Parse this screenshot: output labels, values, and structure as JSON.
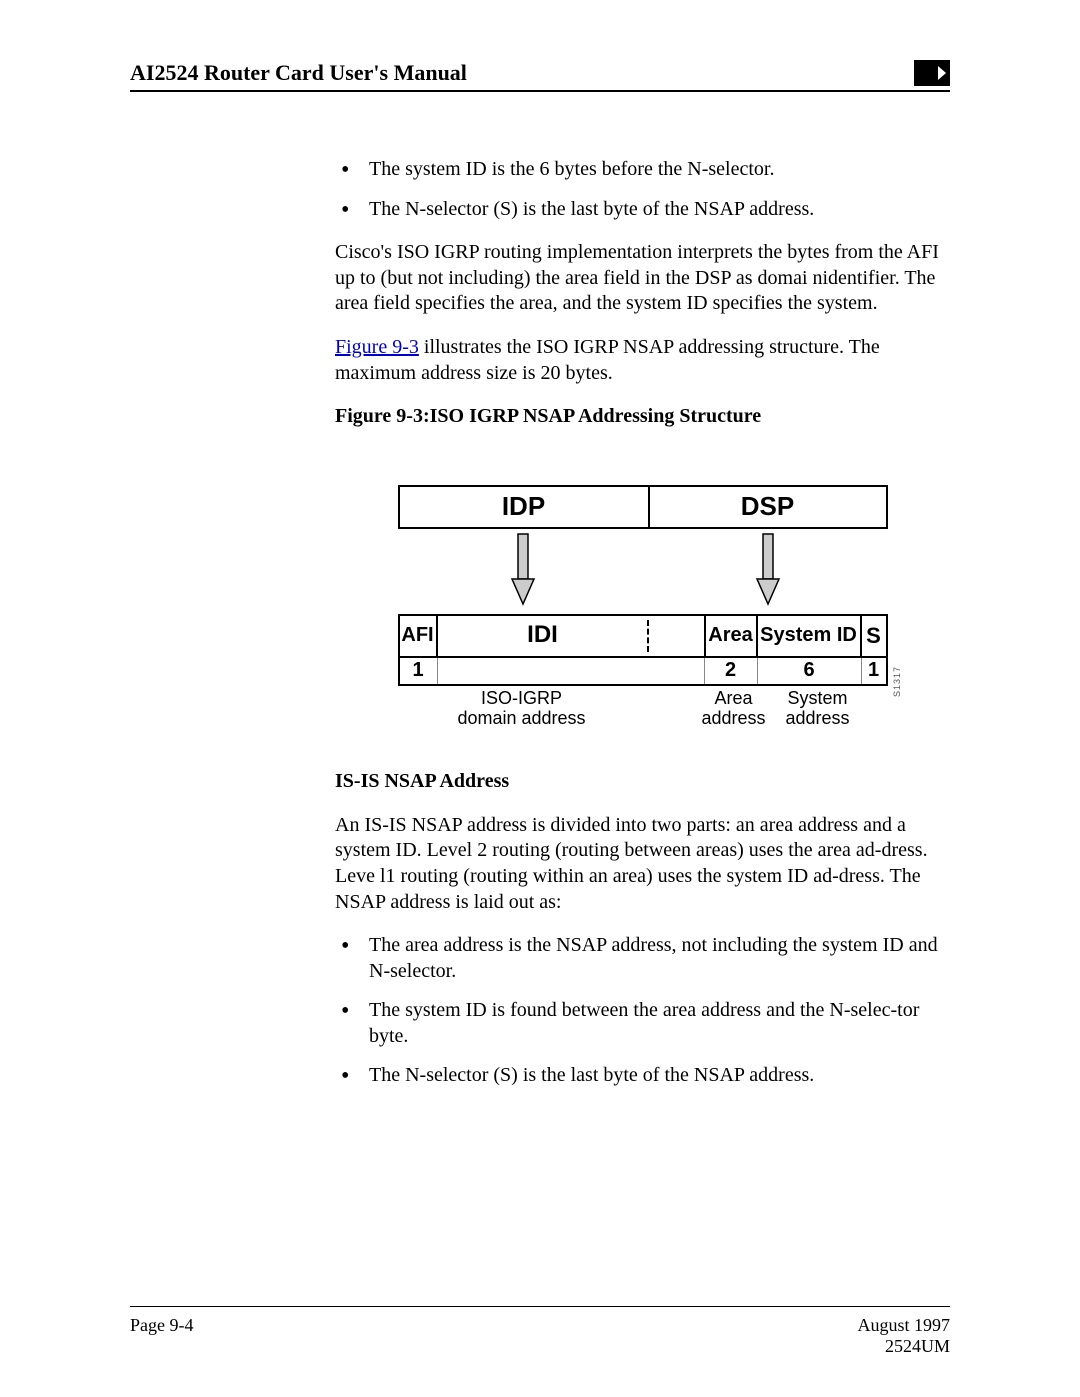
{
  "header": {
    "title": "AI2524 Router Card User's Manual"
  },
  "intro_bullets": [
    "The system ID is the 6 bytes before the N-selector.",
    "The N-selector (S) is the last byte of the NSAP address."
  ],
  "para_cisco": "Cisco's ISO IGRP routing implementation interprets the bytes from the AFI up to (but not including) the area field in the DSP as domai nidentifier. The area field specifies the area, and the system ID specifies the system.",
  "fig_ref_link": "Figure 9-3",
  "fig_ref_rest": " illustrates the ISO IGRP NSAP addressing structure. The maximum address size is 20 bytes.",
  "fig_caption": "Figure 9-3:ISO IGRP NSAP Addressing Structure",
  "diagram": {
    "top": {
      "idp": "IDP",
      "dsp": "DSP"
    },
    "row2": {
      "afi": "AFI",
      "idi": "IDI",
      "area": "Area",
      "sysid": "System ID",
      "sel": "S"
    },
    "row3": {
      "afi": "1",
      "area": "2",
      "sysid": "6",
      "sel": "1"
    },
    "labels": {
      "l1a": "ISO-IGRP",
      "l1b": "domain address",
      "l2a": "Area",
      "l2b": "address",
      "l3a": "System",
      "l3b": "address"
    },
    "side": "S1317"
  },
  "isis_heading": "IS-IS NSAP Address",
  "isis_para": "An IS-IS NSAP address is divided into two parts: an area address and a system ID. Level 2 routing (routing between areas) uses the area ad-dress. Leve l1 routing (routing within an area) uses the system ID ad-dress. The NSAP address is laid out as:",
  "isis_bullets": [
    "The area address is the NSAP address, not including the system ID and N-selector.",
    "The system ID is found between the area address and the N-selec-tor byte.",
    "The N-selector (S) is the last byte of the NSAP address."
  ],
  "footer": {
    "page": "Page 9-4",
    "date": "August 1997",
    "doc": "2524UM"
  }
}
